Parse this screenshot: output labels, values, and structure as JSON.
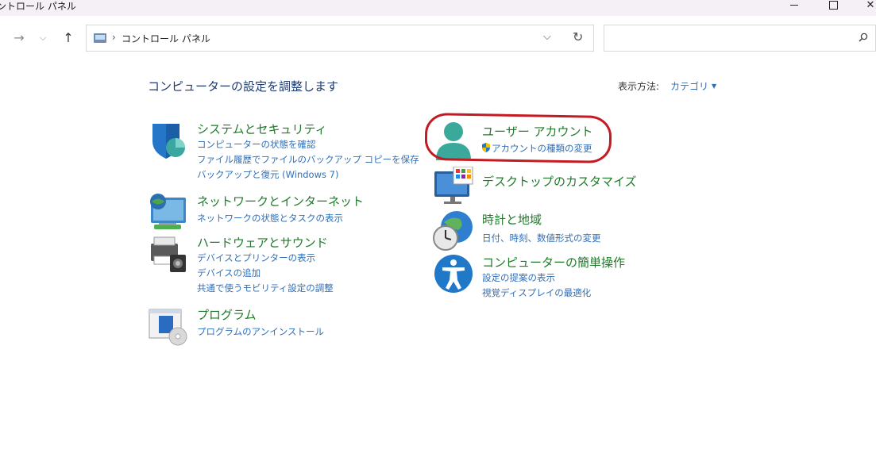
{
  "window": {
    "title": "ントロール パネル"
  },
  "nav": {
    "breadcrumb": "コントロール パネル",
    "search_placeholder": ""
  },
  "header": {
    "title": "コンピューターの設定を調整します",
    "view_label": "表示方法:",
    "view_value": "カテゴリ"
  },
  "categories": {
    "system": {
      "title": "システムとセキュリティ",
      "links": [
        "コンピューターの状態を確認",
        "ファイル履歴でファイルのバックアップ コピーを保存",
        "バックアップと復元 (Windows 7)"
      ]
    },
    "network": {
      "title": "ネットワークとインターネット",
      "links": [
        "ネットワークの状態とタスクの表示"
      ]
    },
    "hardware": {
      "title": "ハードウェアとサウンド",
      "links": [
        "デバイスとプリンターの表示",
        "デバイスの追加",
        "共通で使うモビリティ設定の調整"
      ]
    },
    "programs": {
      "title": "プログラム",
      "links": [
        "プログラムのアンインストール"
      ]
    },
    "user_accounts": {
      "title": "ユーザー アカウント",
      "links": [
        "アカウントの種類の変更"
      ]
    },
    "appearance": {
      "title": "デスクトップのカスタマイズ"
    },
    "clock": {
      "title": "時計と地域",
      "links": [
        "日付、時刻、数値形式の変更"
      ]
    },
    "ease": {
      "title": "コンピューターの簡単操作",
      "links": [
        "設定の提案の表示",
        "視覚ディスプレイの最適化"
      ]
    }
  },
  "colors": {
    "category_title": "#1f7a2a",
    "link": "#2f6fb8",
    "annotation": "#c41a22"
  }
}
